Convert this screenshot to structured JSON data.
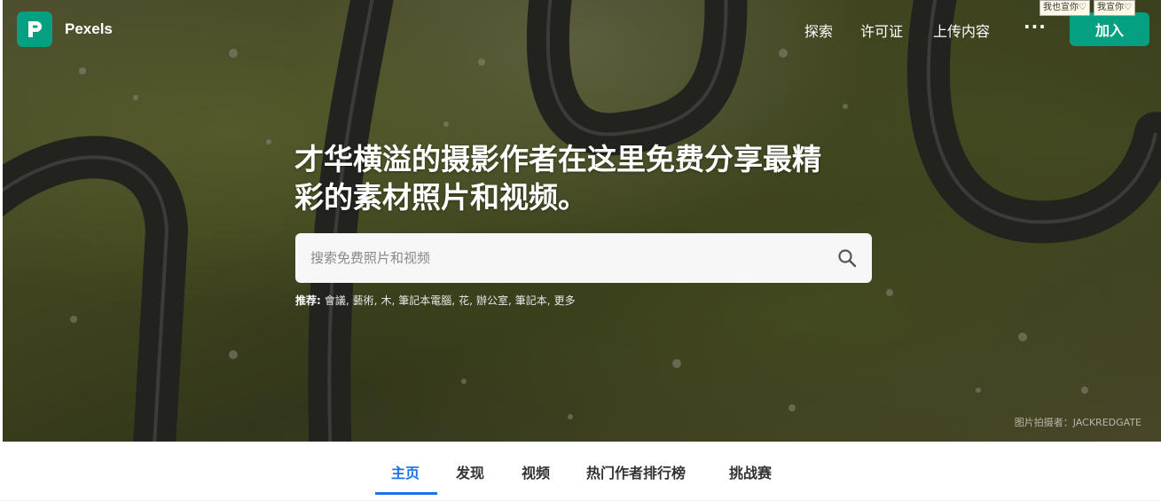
{
  "brand": {
    "name": "Pexels",
    "color": "#05a081"
  },
  "nav": {
    "items": [
      "探索",
      "许可证",
      "上传内容"
    ],
    "more_label": "···",
    "join_label": "加入"
  },
  "stickers": [
    "我也宣你♡",
    "我宣你♡"
  ],
  "hero": {
    "headline_line1": "才华横溢的摄影作者在这里免费分享最精",
    "headline_line2": "彩的素材照片和视频。",
    "search_placeholder": "搜索免费照片和视频",
    "suggestions_label": "推荐:",
    "suggestions": [
      "會議,",
      "藝術,",
      "木,",
      "筆記本電腦,",
      "花,",
      "辦公室,",
      "筆記本,",
      "更多"
    ],
    "credit": "图片拍摄者：JACKREDGATE"
  },
  "tabs": [
    "主页",
    "发现",
    "视频",
    "热门作者排行榜",
    "挑战赛"
  ],
  "active_tab": "主页",
  "accent_color": "#1a73e8"
}
